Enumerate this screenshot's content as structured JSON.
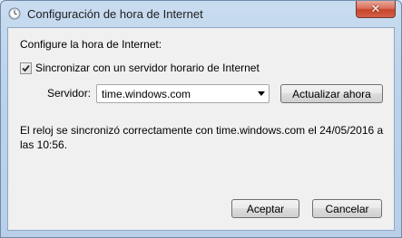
{
  "window": {
    "title": "Configuración de hora de Internet",
    "close_label": "✕"
  },
  "panel": {
    "heading": "Configure la hora de Internet:",
    "sync_checkbox": {
      "label": "Sincronizar con un servidor horario de Internet",
      "checked": true
    },
    "server_label": "Servidor:",
    "server_value": "time.windows.com",
    "update_button": "Actualizar ahora",
    "status_text": "El reloj se sincronizó correctamente con time.windows.com el 24/05/2016 a las 10:56."
  },
  "footer": {
    "ok_button": "Aceptar",
    "cancel_button": "Cancelar"
  },
  "icons": {
    "title": "clock-globe-icon",
    "close": "close-icon",
    "check": "checkmark-icon",
    "dropdown": "chevron-down-icon"
  }
}
